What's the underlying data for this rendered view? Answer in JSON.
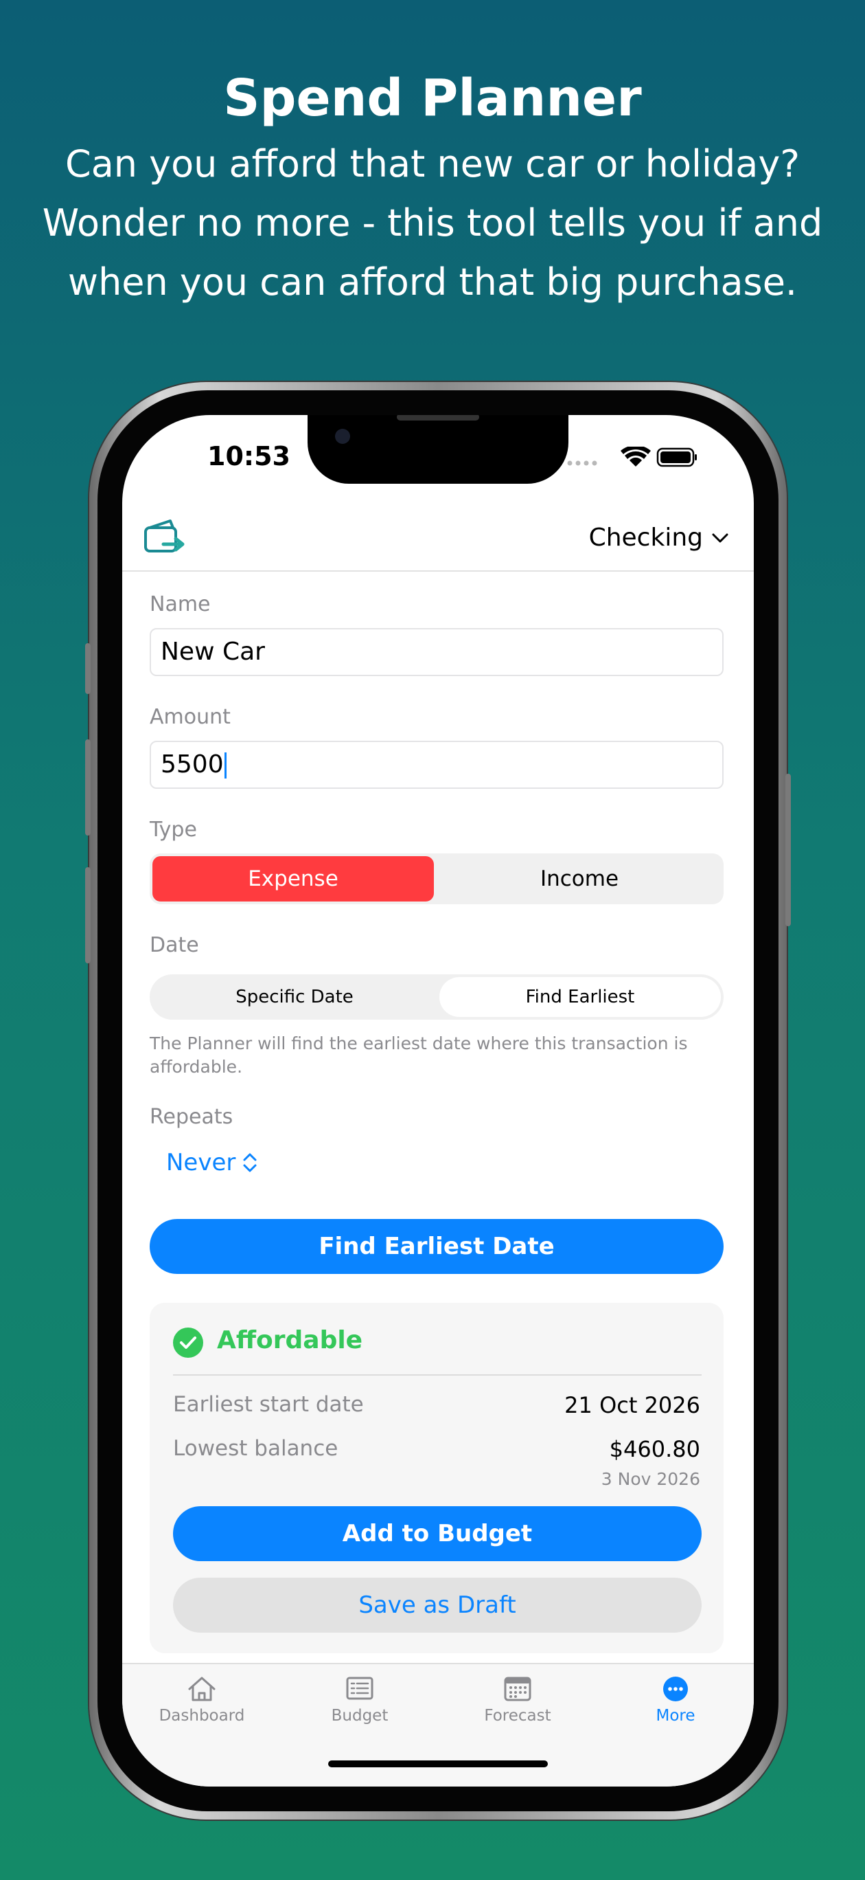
{
  "promo": {
    "title": "Spend Planner",
    "subtitle": "Can you afford that new car or holiday? Wonder no more - this tool tells you if and when you can afford that big purchase."
  },
  "status_bar": {
    "time": "10:53"
  },
  "header": {
    "account": "Checking"
  },
  "form": {
    "name_label": "Name",
    "name_value": "New Car",
    "amount_label": "Amount",
    "amount_value": "5500",
    "type_label": "Type",
    "type_options": [
      "Expense",
      "Income"
    ],
    "type_selected": "Expense",
    "date_label": "Date",
    "date_options": [
      "Specific Date",
      "Find Earliest"
    ],
    "date_selected": "Find Earliest",
    "date_hint": "The Planner will find the earliest date where this transaction is affordable.",
    "repeats_label": "Repeats",
    "repeats_value": "Never",
    "find_button": "Find Earliest Date"
  },
  "result": {
    "status": "Affordable",
    "earliest_label": "Earliest start date",
    "earliest_value": "21 Oct 2026",
    "lowest_label": "Lowest balance",
    "lowest_value": "$460.80",
    "lowest_date": "3 Nov 2026",
    "add_button": "Add to Budget",
    "draft_button": "Save as Draft"
  },
  "tabs": [
    {
      "label": "Dashboard",
      "icon": "house-icon"
    },
    {
      "label": "Budget",
      "icon": "list-icon"
    },
    {
      "label": "Forecast",
      "icon": "calendar-icon"
    },
    {
      "label": "More",
      "icon": "more-icon"
    }
  ],
  "active_tab": "More",
  "colors": {
    "accent": "#0a84ff",
    "expense": "#ff3b3f",
    "affordable": "#34c759",
    "teal_icon": "#1a8a93"
  }
}
